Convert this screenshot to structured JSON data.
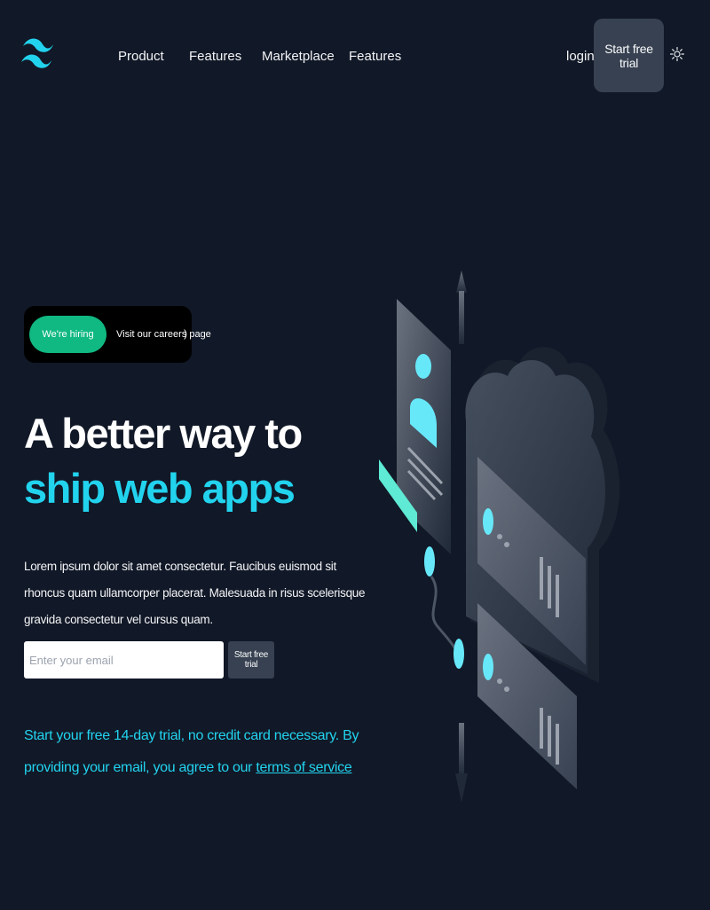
{
  "nav": {
    "links": [
      {
        "label": "Product"
      },
      {
        "label": "Features"
      },
      {
        "label": "Marketplace"
      },
      {
        "label": "Features"
      }
    ],
    "login_label": "login",
    "trial_label": "Start free trial"
  },
  "hiring": {
    "badge": "We're hiring",
    "link_text": "Visit our careers page",
    "chevron": ")"
  },
  "hero": {
    "title_plain": "A better way to",
    "title_accent": "ship web apps",
    "description": "Lorem ipsum dolor sit amet consectetur. Faucibus euismod sit rhoncus quam ullamcorper placerat. Malesuada in risus scelerisque gravida consectetur vel cursus quam.",
    "email_placeholder": "Enter your email",
    "email_button": "Start free trial",
    "note_prefix": "Start your free 14-day trial, no credit card necessary. By providing your email, you agree to our",
    "note_link": "terms of service"
  },
  "colors": {
    "background": "#111827",
    "accent": "#22d3ee",
    "badge_green": "#10b981",
    "button_gray": "#374151"
  },
  "icons": {
    "logo": "wave-logo-icon",
    "theme_toggle": "sun-icon",
    "chevron": "chevron-right-icon"
  }
}
